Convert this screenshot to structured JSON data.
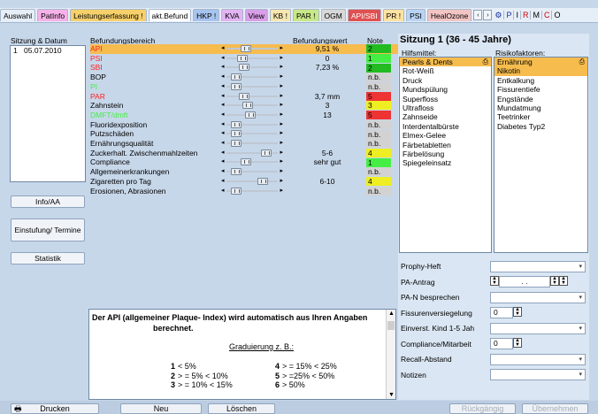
{
  "tabs": [
    {
      "label": "Auswahl",
      "bg": "#e6eef7",
      "color": "#000"
    },
    {
      "label": "PatInfo",
      "bg": "#f6b1e8",
      "color": "#000"
    },
    {
      "label": "Leistungserfassung !",
      "bg": "#f6d06a",
      "color": "#000"
    },
    {
      "label": "akt.Befund",
      "bg": "#ffffff",
      "color": "#000"
    },
    {
      "label": "HKP !",
      "bg": "#a7c4f0",
      "color": "#000"
    },
    {
      "label": "KVA",
      "bg": "#e3b3f2",
      "color": "#000"
    },
    {
      "label": "View",
      "bg": "#d89ee8",
      "color": "#000"
    },
    {
      "label": "KB !",
      "bg": "#f7e6b0",
      "color": "#000"
    },
    {
      "label": "PAR !",
      "bg": "#c8e888",
      "color": "#000"
    },
    {
      "label": "OGM",
      "bg": "#d8d8d8",
      "color": "#000"
    },
    {
      "label": "API/SBI",
      "bg": "#e05050",
      "color": "#fff"
    },
    {
      "label": "PR !",
      "bg": "#ffe3a0",
      "color": "#000"
    },
    {
      "label": "PSI",
      "bg": "#b8d4f4",
      "color": "#000"
    },
    {
      "label": "HealOzone",
      "bg": "#f3c4c4",
      "color": "#000"
    }
  ],
  "tab_markers": [
    {
      "label": "P",
      "color": "#1a2fa0"
    },
    {
      "label": "I",
      "color": "#000"
    },
    {
      "label": "R",
      "color": "#d00000"
    },
    {
      "label": "M",
      "color": "#000"
    },
    {
      "label": "C",
      "color": "#d00000"
    },
    {
      "label": "O",
      "color": "#000"
    }
  ],
  "left": {
    "header": "Sitzung & Datum",
    "sessions": [
      {
        "nr": "1",
        "date": "05.07.2010"
      }
    ],
    "buttons": [
      "Info/AA",
      "Einstufung/ Termine",
      "Statistik"
    ]
  },
  "findings": {
    "col_area": "Befundungsbereich",
    "col_value": "Befundungswert",
    "col_note": "Note",
    "rows": [
      {
        "name": "API",
        "color": "#ff2020",
        "value": "9,51 %",
        "note": "2",
        "note_bg": "#22bb22",
        "slider": 0.35,
        "selected": true
      },
      {
        "name": "PSI",
        "color": "#ff2020",
        "value": "0",
        "note": "1",
        "note_bg": "#44ee44",
        "slider": 0.25,
        "selected": false
      },
      {
        "name": "SBI",
        "color": "#ff2020",
        "value": "7,23 %",
        "note": "2",
        "note_bg": "#22bb22",
        "slider": 0.3,
        "selected": false
      },
      {
        "name": "BOP",
        "color": "#000",
        "value": "",
        "note": "n.b.",
        "note_bg": "#d2d2d2",
        "slider": 0.1,
        "selected": false
      },
      {
        "name": "PI",
        "color": "#44ee44",
        "value": "",
        "note": "n.b.",
        "note_bg": "#d2d2d2",
        "slider": 0.1,
        "selected": false
      },
      {
        "name": "PAR",
        "color": "#ff2020",
        "value": "3,7 mm",
        "note": "5",
        "note_bg": "#ee3333",
        "slider": 0.3,
        "selected": false
      },
      {
        "name": "Zahnstein",
        "color": "#000",
        "value": "3",
        "note": "3",
        "note_bg": "#eeee22",
        "slider": 0.4,
        "selected": false
      },
      {
        "name": "DMFT/dmft",
        "color": "#44ee44",
        "value": "13",
        "note": "5",
        "note_bg": "#ee3333",
        "slider": 0.45,
        "selected": false
      },
      {
        "name": "Fluoridexposition",
        "color": "#000",
        "value": "",
        "note": "n.b.",
        "note_bg": "#d2d2d2",
        "slider": 0.1,
        "selected": false
      },
      {
        "name": "Putzschäden",
        "color": "#000",
        "value": "",
        "note": "n.b.",
        "note_bg": "#d2d2d2",
        "slider": 0.1,
        "selected": false
      },
      {
        "name": "Ernährungsqualität",
        "color": "#000",
        "value": "",
        "note": "n.b.",
        "note_bg": "#d2d2d2",
        "slider": 0.1,
        "selected": false
      },
      {
        "name": "Zuckerhalt. Zwischenmahlzeiten",
        "color": "#000",
        "value": "5-6",
        "note": "4",
        "note_bg": "#eeee22",
        "slider": 0.85,
        "selected": false
      },
      {
        "name": "Compliance",
        "color": "#000",
        "value": "sehr gut",
        "note": "1",
        "note_bg": "#44ee44",
        "slider": 0.35,
        "selected": false
      },
      {
        "name": "Allgemeinerkrankungen",
        "color": "#000",
        "value": "",
        "note": "n.b.",
        "note_bg": "#d2d2d2",
        "slider": 0.1,
        "selected": false
      },
      {
        "name": "Zigaretten pro Tag",
        "color": "#000",
        "value": "6-10",
        "note": "4",
        "note_bg": "#eeee22",
        "slider": 0.75,
        "selected": false
      },
      {
        "name": "Erosionen, Abrasionen",
        "color": "#000",
        "value": "",
        "note": "n.b.",
        "note_bg": "#d2d2d2",
        "slider": 0.1,
        "selected": false
      }
    ]
  },
  "info": {
    "title_line1": "Der API (allgemeiner Plaque- Index) wird automatisch aus Ihren Angaben",
    "title_line2": "berechnet.",
    "subtitle": "Graduierung z. B.:",
    "grades": [
      {
        "n": "1",
        "t": "< 5%"
      },
      {
        "n": "4",
        "t": "> = 15% < 25%"
      },
      {
        "n": "2",
        "t": "> = 5% < 10%"
      },
      {
        "n": "5",
        "t": "> =25% < 50%"
      },
      {
        "n": "3",
        "t": "> = 10% < 15%"
      },
      {
        "n": "6",
        "t": "> 50%"
      }
    ]
  },
  "session": {
    "title": "Sitzung 1 (36 - 45 Jahre)",
    "hilfsmittel_label": "Hilfsmittel:",
    "risiko_label": "Risikofaktoren:",
    "hilfsmittel": [
      "Pearls & Dents",
      "Rot-Weiß",
      "Druck",
      "Mundspülung",
      "Superfloss",
      "Ultrafloss",
      "Zahnseide",
      "Interdentalbürste",
      "Elmex-Gelee",
      "Färbetabletten",
      "Färbelösung",
      "Spiegeleinsatz"
    ],
    "risiko": [
      "Ernährung",
      "Nikotin",
      "Entkalkung",
      "Fissurentiefe",
      "Engstände",
      "Mundatmung",
      "Teetrinker",
      "Diabetes Typ2"
    ],
    "fields": [
      {
        "label": "Prophy-Heft",
        "type": "dd",
        "value": ""
      },
      {
        "label": "PA-Antrag",
        "type": "date",
        "value": ". ."
      },
      {
        "label": "PA-N besprechen",
        "type": "dd",
        "value": ""
      },
      {
        "label": "Fissurenversiegelung",
        "type": "num",
        "value": "0"
      },
      {
        "label": "Einverst. Kind 1-5 Jah",
        "type": "dd",
        "value": ""
      },
      {
        "label": "Compliance/Mitarbeit",
        "type": "num",
        "value": "0"
      },
      {
        "label": "Recall-Abstand",
        "type": "dd",
        "value": ""
      },
      {
        "label": "Notizen",
        "type": "dd",
        "value": ""
      }
    ]
  },
  "bottom": {
    "print": "Drucken",
    "new": "Neu",
    "delete": "Löschen",
    "undo": "Rückgängig",
    "apply": "Übernehmen"
  }
}
